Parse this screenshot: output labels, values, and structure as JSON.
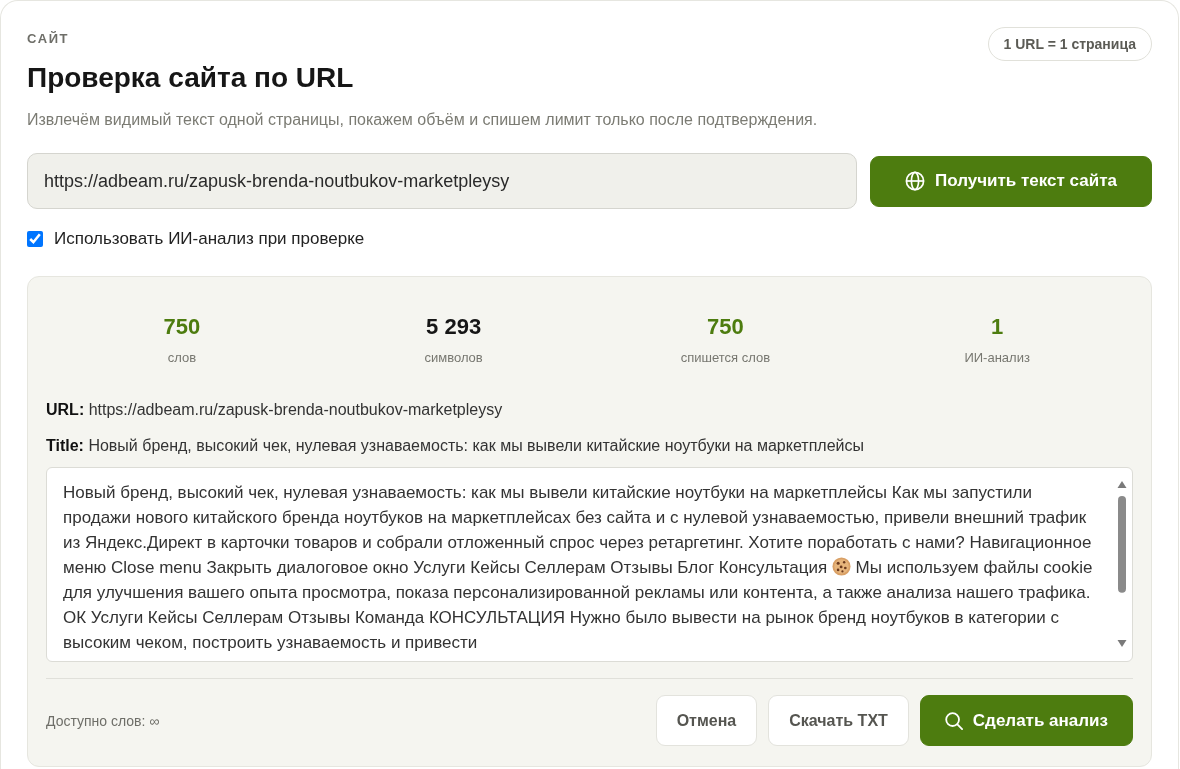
{
  "section_label": "САЙТ",
  "badge": "1 URL = 1 страница",
  "title": "Проверка сайта по URL",
  "subtitle": "Извлечём видимый текст одной страницы, покажем объём и спишем лимит только после подтверждения.",
  "url_field": {
    "value": "https://adbeam.ru/zapusk-brenda-noutbukov-marketpleysy"
  },
  "fetch_button": {
    "label": "Получить текст сайта"
  },
  "ai_option": {
    "label": "Использовать ИИ-анализ при проверке",
    "checked": true
  },
  "result": {
    "stats": [
      {
        "value": "750",
        "label": "слов",
        "color": "#4d7c0f"
      },
      {
        "value": "5 293",
        "label": "символов",
        "color": "#161616"
      },
      {
        "value": "750",
        "label": "спишется слов",
        "color": "#4d7c0f"
      },
      {
        "value": "1",
        "label": "ИИ-анализ",
        "color": "#4d7c0f"
      }
    ],
    "details": [
      "**URL:** https://adbeam.ru/zapusk-brenda-noutbukov-marketpleysy",
      "**Title:** Новый бренд, высокий чек, нулевая узнаваемость: как мы вывели китайские ноутбуки на маркетплейсы"
    ],
    "page_text": [
      {
        "kind": "text",
        "text": "Новый бренд, высокий чек, нулевая узнаваемость: как мы вывели китайские ноутбуки на маркетплейсы Как мы запустили продажи нового китайского бренда ноутбуков на маркетплейсах без сайта и с нулевой узнаваемостью, привели внешний трафик из Яндекс.Директ в карточки товаров и собрали отложенный спрос через ретаргетинг. Хотите поработать с нами? Навигационное меню Close menu Закрыть диалоговое окно Услуги Кейсы Селлерам Отзывы Блог Консультация"
      },
      {
        "kind": "cookie"
      },
      {
        "kind": "text",
        "text": "Мы используем файлы cookie для улучшения вашего опыта просмотра, показа персонализированной рекламы или контента, а также анализа нашего трафика. ОК Услуги Кейсы Селлерам Отзывы Команда КОНСУЛЬТАЦИЯ Нужно было вывести на рынок бренд ноутбуков в категории с высоким чеком, построить узнаваемость и привести"
      }
    ],
    "available": "Доступно слов: ∞",
    "buttons": [
      {
        "label": "Отмена",
        "kind": "secondary"
      },
      {
        "label": "Скачать TXT",
        "kind": "secondary"
      },
      {
        "label": "Сделать анализ",
        "kind": "primary"
      }
    ]
  }
}
